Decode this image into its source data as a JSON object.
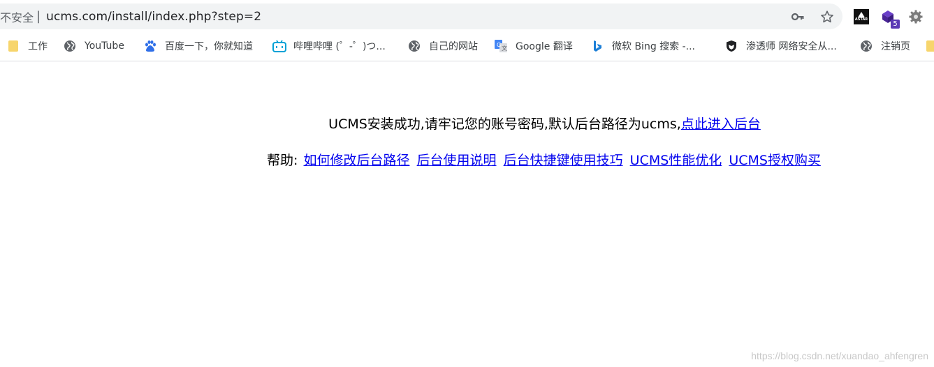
{
  "address_bar": {
    "security_label": "不安全",
    "separator": "|",
    "url": "ucms.com/install/index.php?step=2"
  },
  "extensions": {
    "astar_label": "ASTAR",
    "badge_count": "5"
  },
  "bookmarks": [
    {
      "label": "工作",
      "icon": "folder-icon"
    },
    {
      "label": "YouTube",
      "icon": "globe-icon"
    },
    {
      "label": "百度一下，你就知道",
      "icon": "baidu-paw-icon"
    },
    {
      "label": "哔哩哔哩 (゜-゜)つ...",
      "icon": "bilibili-icon"
    },
    {
      "label": "自己的网站",
      "icon": "globe-icon"
    },
    {
      "label": "Google 翻译",
      "icon": "google-translate-icon"
    },
    {
      "label": "微软 Bing 搜索 -...",
      "icon": "bing-icon"
    },
    {
      "label": "渗透师 网络安全从...",
      "icon": "shield-icon"
    },
    {
      "label": "注销页",
      "icon": "globe-icon"
    }
  ],
  "main": {
    "success_text": "UCMS安装成功,请牢记您的账号密码,默认后台路径为ucms,",
    "admin_link": "点此进入后台",
    "help_label": "帮助:",
    "help_links": [
      "如何修改后台路径",
      "后台使用说明",
      "后台快捷键使用技巧",
      "UCMS性能优化",
      "UCMS授权购买"
    ]
  },
  "watermark": "https://blog.csdn.net/xuandao_ahfengren",
  "colors": {
    "link": "#0000ee",
    "omnibox_bg": "#f1f3f4",
    "folder": "#f7d56c",
    "bilibili": "#00a1d6",
    "baidu": "#2f6fe8"
  }
}
